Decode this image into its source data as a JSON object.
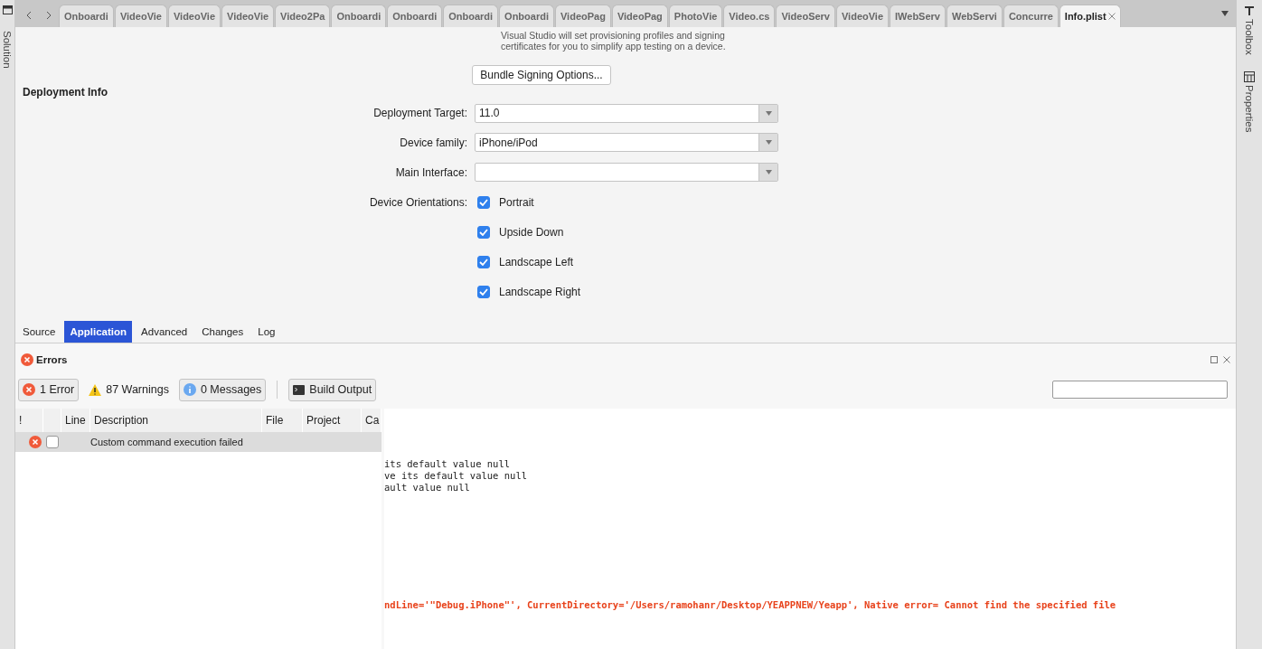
{
  "left_sidebar": {
    "label": "Solution"
  },
  "tab_bar": {
    "tabs": [
      {
        "label": "Onboardi",
        "selected": false
      },
      {
        "label": "VideoVie",
        "selected": false
      },
      {
        "label": "VideoVie",
        "selected": false
      },
      {
        "label": "VideoVie",
        "selected": false
      },
      {
        "label": "Video2Pa",
        "selected": false
      },
      {
        "label": "Onboardi",
        "selected": false
      },
      {
        "label": "Onboardi",
        "selected": false
      },
      {
        "label": "Onboardi",
        "selected": false
      },
      {
        "label": "Onboardi",
        "selected": false
      },
      {
        "label": "VideoPag",
        "selected": false
      },
      {
        "label": "VideoPag",
        "selected": false
      },
      {
        "label": "PhotoVie",
        "selected": false
      },
      {
        "label": "Video.cs",
        "selected": false
      },
      {
        "label": "VideoServ",
        "selected": false
      },
      {
        "label": "VideoVie",
        "selected": false
      },
      {
        "label": "IWebServ",
        "selected": false
      },
      {
        "label": "WebServi",
        "selected": false
      },
      {
        "label": "Concurre",
        "selected": false
      },
      {
        "label": "Info.plist",
        "selected": true
      }
    ]
  },
  "right_sidebar": {
    "items": [
      {
        "label": "Toolbox",
        "kind": "toolbox"
      },
      {
        "label": "Properties",
        "kind": "properties"
      }
    ]
  },
  "signing": {
    "description": [
      "Visual Studio will set provisioning profiles and signing",
      "certificates for you to simplify app testing on a device."
    ],
    "button": "Bundle Signing Options..."
  },
  "deployment_info": {
    "title": "Deployment Info",
    "fields": [
      {
        "label": "Deployment Target:",
        "value": "11.0"
      },
      {
        "label": "Device family:",
        "value": "iPhone/iPod"
      },
      {
        "label": "Main Interface:"
      }
    ],
    "orientations": {
      "label": "Device Orientations:",
      "options": [
        {
          "label": "Portrait",
          "checked": true
        },
        {
          "label": "Upside Down",
          "checked": true
        },
        {
          "label": "Landscape Left",
          "checked": true
        },
        {
          "label": "Landscape Right",
          "checked": true
        }
      ]
    }
  },
  "editor_tabs": [
    {
      "label": "Source",
      "selected": false
    },
    {
      "label": "Application",
      "selected": true
    },
    {
      "label": "Advanced",
      "selected": false
    },
    {
      "label": "Changes",
      "selected": false
    },
    {
      "label": "Log",
      "selected": false
    }
  ],
  "errors_pad": {
    "title": "Errors",
    "filters": [
      {
        "label": "1 Error",
        "kind": "error",
        "selected": true
      },
      {
        "label": "87 Warnings",
        "kind": "warning",
        "selected": false
      },
      {
        "label": "0 Messages",
        "kind": "info",
        "selected": true
      }
    ],
    "build_output": "Build Output",
    "columns": [
      "!",
      "",
      "Line",
      "Description",
      "File",
      "Project",
      "Ca"
    ],
    "rows": [
      {
        "description": "Custom command execution failed",
        "checked": false,
        "selected": true
      }
    ],
    "output_lines": [
      {
        "text": "its default value null",
        "kind": "normal"
      },
      {
        "text": "ve its default value null",
        "kind": "normal"
      },
      {
        "text": "ault value null",
        "kind": "normal"
      },
      {
        "text": "ndLine='\"Debug.iPhone\"', CurrentDirectory='/Users/ramohanr/Desktop/YEAPPNEW/Yeapp', Native error= Cannot find the specified file",
        "kind": "error"
      }
    ]
  }
}
